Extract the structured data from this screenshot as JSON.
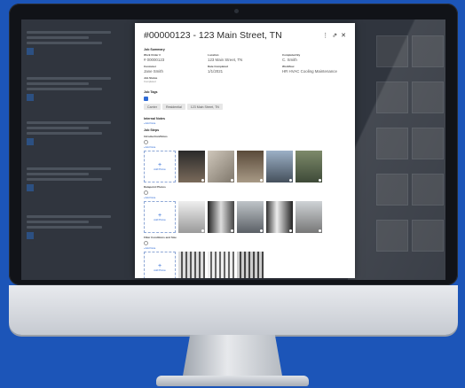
{
  "modal": {
    "title": "#00000123 - 123 Main Street, TN",
    "header_icons": [
      "more-icon",
      "export-icon",
      "close-icon"
    ],
    "job_summary": {
      "heading": "Job Summary",
      "fields": [
        {
          "label": "Work Order #",
          "value": "# 00000123"
        },
        {
          "label": "Location",
          "value": "123 Main Street, TN"
        },
        {
          "label": "Completed By",
          "value": "C. Smith"
        },
        {
          "label": "Customer",
          "value": "Jane Smith"
        },
        {
          "label": "Date Completed",
          "value": "1/1/2021"
        },
        {
          "label": "Workflow",
          "value": "HR HVAC Cooling Maintenance"
        }
      ],
      "job_status": {
        "label": "Job Status",
        "value": "Completed"
      }
    },
    "job_tags": {
      "heading": "Job Tags",
      "tags": [
        "Carrier",
        "Residential",
        "123 Main Street, TN"
      ]
    },
    "internal_notes": {
      "heading": "Internal Notes",
      "link": "+Add Note"
    },
    "job_steps": {
      "heading": "Job Steps",
      "steps": [
        {
          "label": "Introduction/Notes",
          "link": "+Add Note",
          "add_label": "Add Photos",
          "photo_count": 5
        },
        {
          "label": "Datapoint Photos",
          "link": "+Add Note",
          "add_label": "Add Photos",
          "photo_count": 5
        },
        {
          "label": "Filter Conditions and Size",
          "link": "+Add Note",
          "add_label": "Add Photos",
          "photo_count": 3
        }
      ]
    }
  },
  "colors": {
    "background": "#1c55b8",
    "accent": "#2f6bd6"
  }
}
